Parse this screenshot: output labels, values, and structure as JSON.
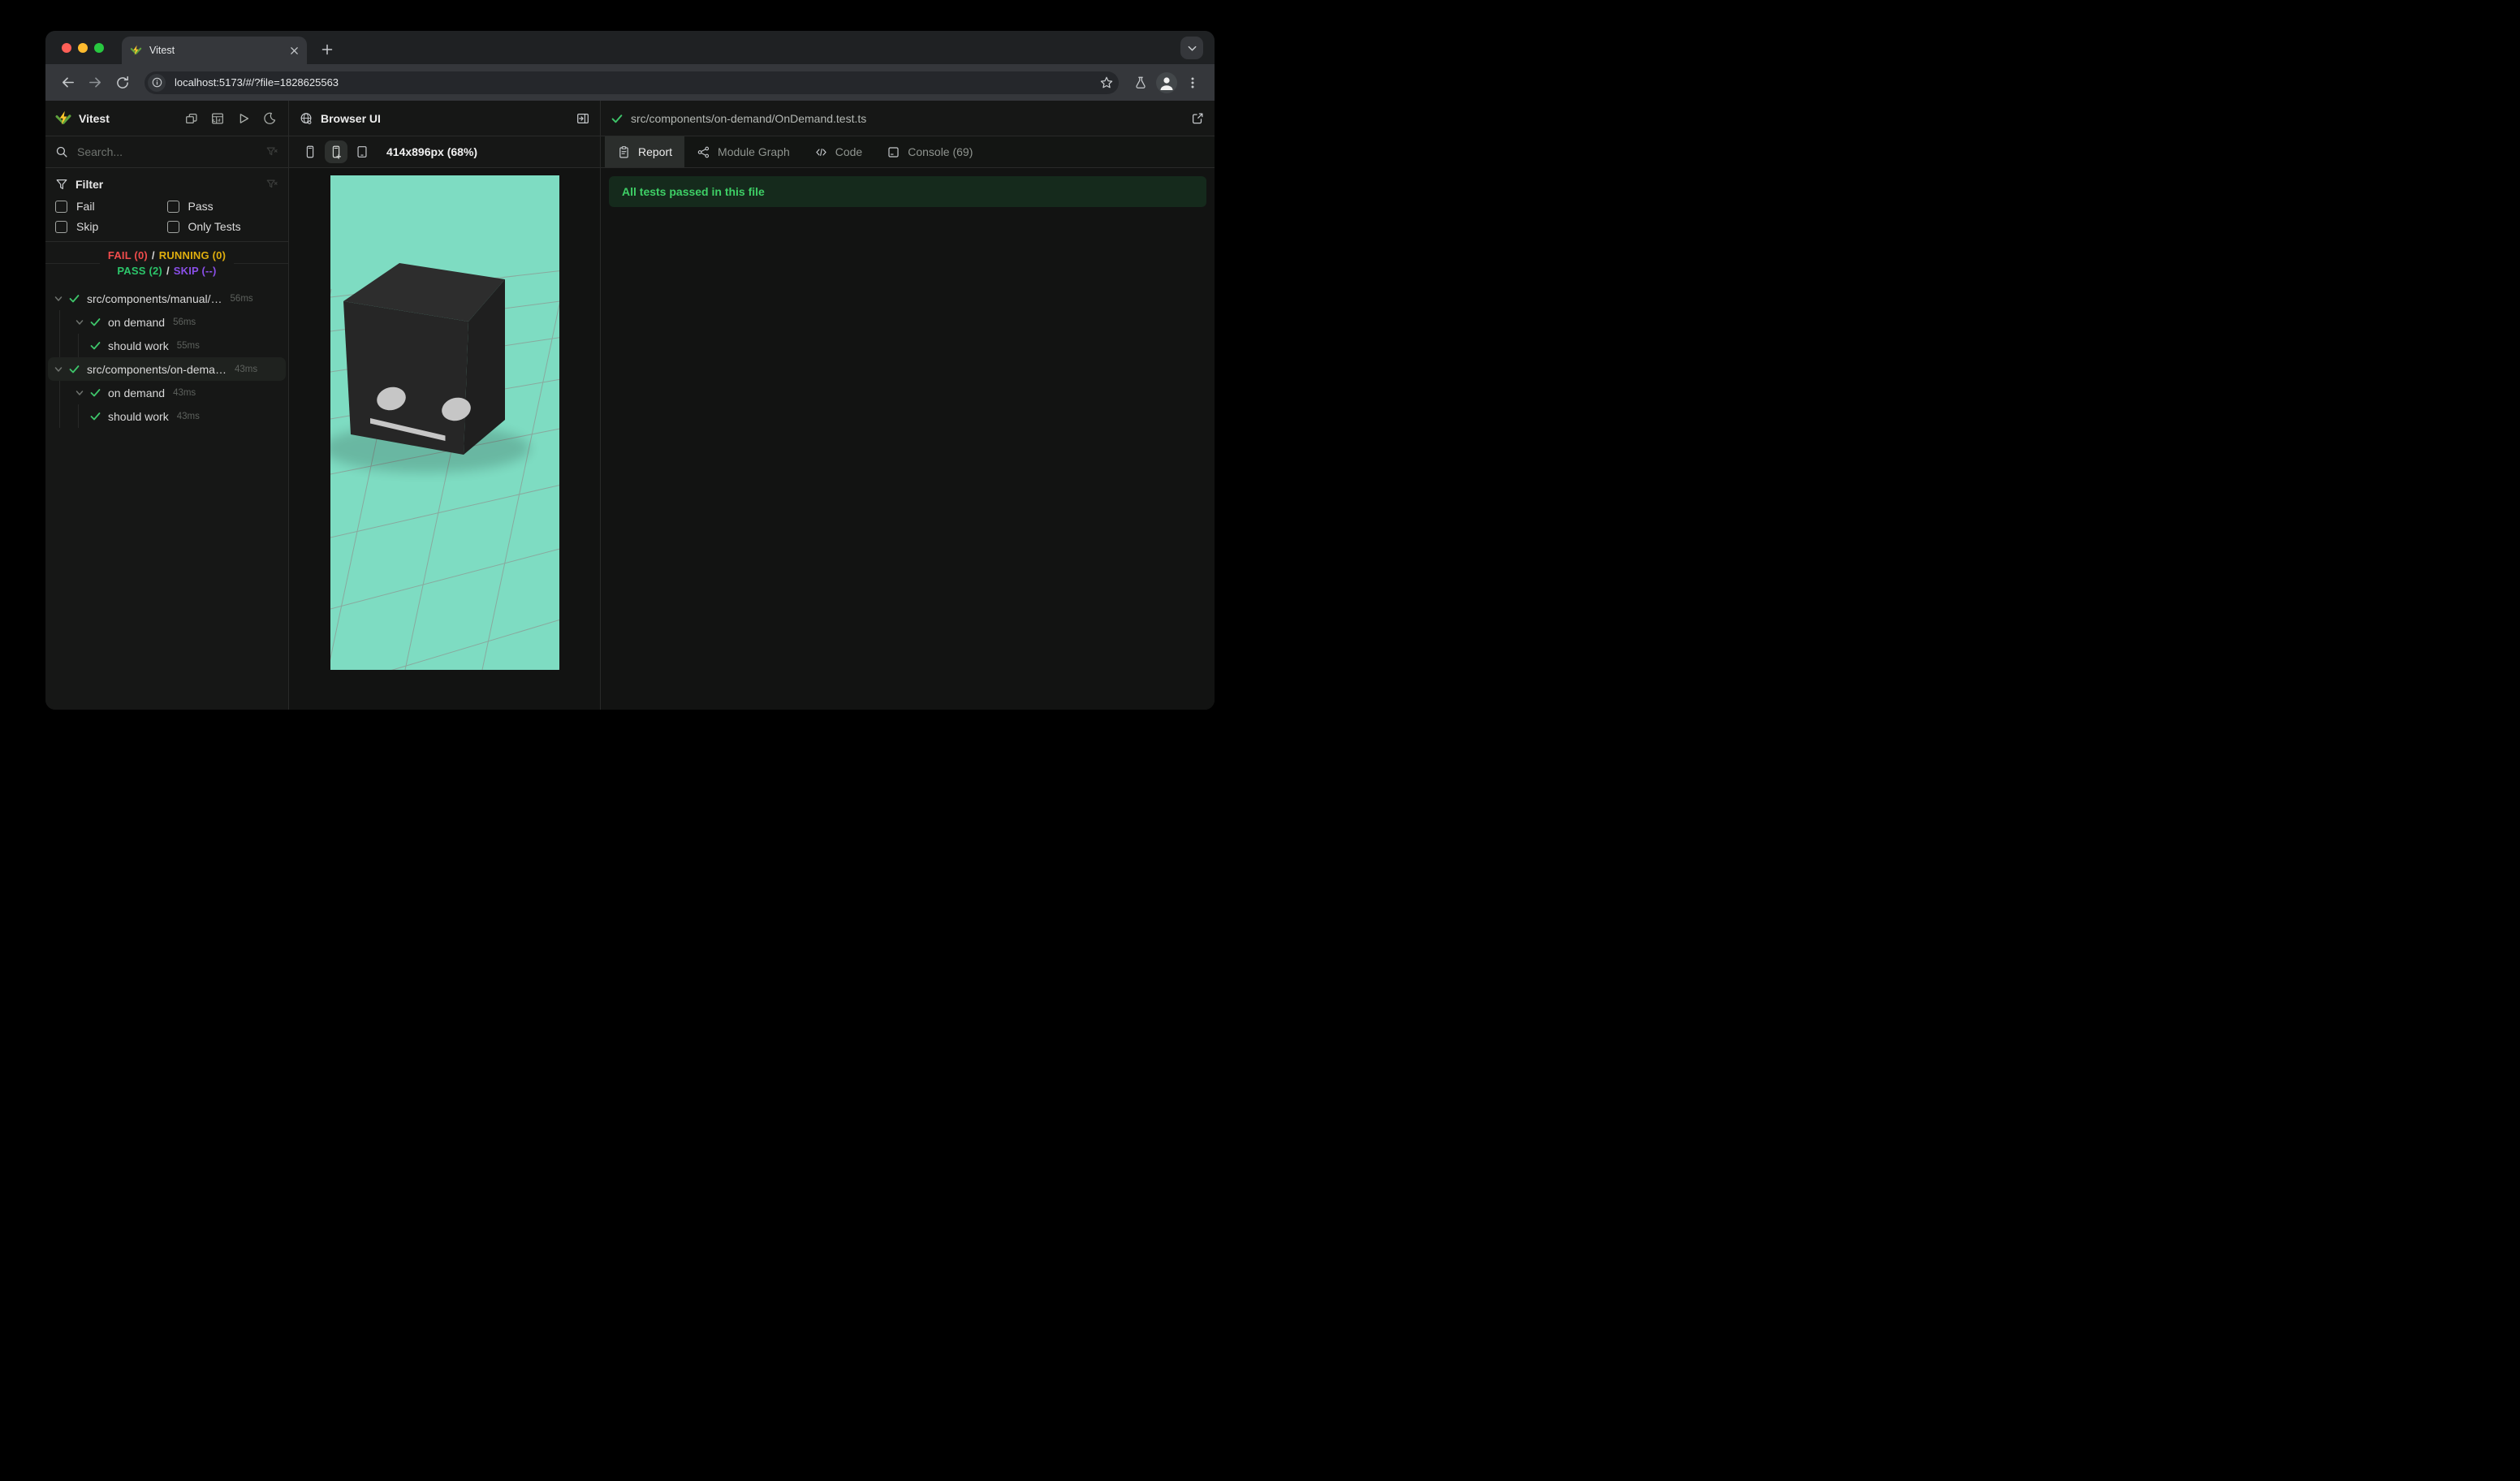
{
  "theme": {
    "chrome-strip": "#1f2123",
    "chrome-surface": "#35373b",
    "chrome-pill": "#25272b",
    "chrome-icon": "#c6c9cc",
    "chrome-icon-dim": "#8e9296",
    "chrome-text": "#e5e7e9",
    "app-bg": "#161716",
    "app-bg-dark": "#121312",
    "border": "#292a29",
    "elev": "#2d302e",
    "icon": "#aaaeaa",
    "text-faint": "#5d615d",
    "green": "#3ec56a",
    "red": "#f14c4c",
    "yellow": "#dfae0e",
    "purple": "#8a4fe8",
    "pass-green": "#2cc56a",
    "banner-bg": "#152a1c",
    "banner-text": "#3ecf66",
    "select-bg": "#1f221f",
    "viewport-bg": "#7edcc2",
    "grid-line": "#8d9892",
    "cube-top": "#2d2d2d",
    "cube-front": "#262626",
    "cube-side": "#1f1f1f",
    "cube-feature": "#c6c6c6",
    "traffic-red": "#ff5f57",
    "traffic-yellow": "#febb2e",
    "traffic-green": "#28c840"
  },
  "chrome": {
    "tab_title": "Vitest",
    "url": "localhost:5173/#/?file=1828625563"
  },
  "sidebar": {
    "title": "Vitest",
    "search_placeholder": "Search...",
    "filter_label": "Filter",
    "filters": {
      "fail": "Fail",
      "pass": "Pass",
      "skip": "Skip",
      "only": "Only Tests"
    },
    "status": {
      "fail": "FAIL (0)",
      "running": "RUNNING (0)",
      "pass": "PASS (2)",
      "skip": "SKIP (--)",
      "sep": "/"
    },
    "tree": [
      {
        "label": "src/components/manual/…",
        "time": "56ms"
      },
      {
        "label": "on demand",
        "time": "56ms"
      },
      {
        "label": "should work",
        "time": "55ms"
      },
      {
        "label": "src/components/on-dema…",
        "time": "43ms"
      },
      {
        "label": "on demand",
        "time": "43ms"
      },
      {
        "label": "should work",
        "time": "43ms"
      }
    ]
  },
  "browser_panel": {
    "title": "Browser UI",
    "size_label": "414x896px (68%)"
  },
  "report_panel": {
    "file_path": "src/components/on-demand/OnDemand.test.ts",
    "tabs": {
      "report": "Report",
      "module_graph": "Module Graph",
      "code": "Code",
      "console": "Console (69)"
    },
    "banner": "All tests passed in this file"
  }
}
